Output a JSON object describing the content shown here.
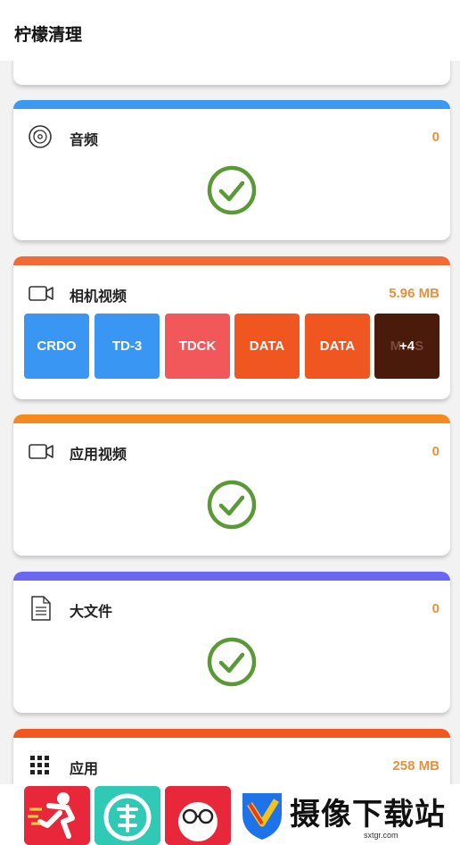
{
  "app": {
    "title": "柠檬清理"
  },
  "cards": {
    "audio": {
      "label": "音频",
      "size": "0",
      "bar_color": "#3b9af0",
      "icon": "disc-icon"
    },
    "camera": {
      "label": "相机视频",
      "size": "5.96 MB",
      "bar_color": "#f26a35",
      "icon": "video-camera-icon",
      "thumbs": [
        {
          "text": "CRDO",
          "color": "#3996f2"
        },
        {
          "text": "TD-3",
          "color": "#3996f2"
        },
        {
          "text": "TDCK",
          "color": "#f2575a"
        },
        {
          "text": "DATA",
          "color": "#f0561f"
        },
        {
          "text": "DATA",
          "color": "#f0561f"
        },
        {
          "text": "M…S",
          "more": "+4",
          "color": "#4a1a0a"
        }
      ]
    },
    "app_video": {
      "label": "应用视频",
      "size": "0",
      "bar_color": "#f28a1e",
      "icon": "video-camera-icon"
    },
    "big_file": {
      "label": "大文件",
      "size": "0",
      "bar_color": "#6b67f2",
      "icon": "document-icon"
    },
    "apps": {
      "label": "应用",
      "size": "258 MB",
      "bar_color": "#f2571e",
      "icon": "grid-icon"
    }
  },
  "watermark": {
    "text": "摄像下载站",
    "url": "sxtgr.com"
  },
  "colors": {
    "check": "#5a9a35",
    "size_text": "#e8903a"
  }
}
